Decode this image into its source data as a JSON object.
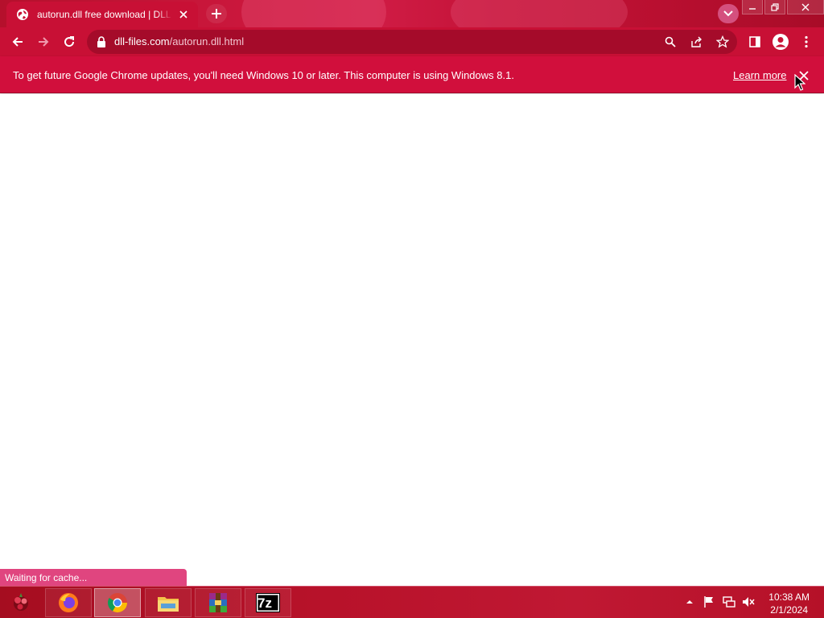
{
  "browser": {
    "tab": {
      "title": "autorun.dll free download | DLL-files.com",
      "favicon": "globe-icon"
    },
    "window_controls": [
      "minimize-icon",
      "restore-icon",
      "close-icon"
    ],
    "toolbar": {
      "back": "back-arrow-icon",
      "forward": "forward-arrow-icon",
      "reload": "reload-icon",
      "url_host": "dll-files.com",
      "url_path": "/autorun.dll.html",
      "omnibox_icons": [
        "search-icon",
        "share-icon",
        "star-icon"
      ],
      "right_icons": [
        "side-panel-icon",
        "profile-icon",
        "menu-dots-icon"
      ]
    },
    "infobar": {
      "message": "To get future Google Chrome updates, you'll need Windows 10 or later. This computer is using Windows 8.1.",
      "learn_more": "Learn more"
    },
    "status": "Waiting for cache..."
  },
  "taskbar": {
    "apps": [
      {
        "name": "Firefox",
        "icon": "firefox-icon"
      },
      {
        "name": "Google Chrome",
        "icon": "chrome-icon",
        "active": true
      },
      {
        "name": "File Explorer",
        "icon": "file-explorer-icon"
      },
      {
        "name": "WinRAR",
        "icon": "winrar-icon"
      },
      {
        "name": "7-Zip",
        "icon": "7zip-icon",
        "label": "7z"
      }
    ],
    "tray_icons": [
      "show-hidden-icons-chevron",
      "action-center-flag-icon",
      "network-icon",
      "volume-muted-icon"
    ],
    "time": "10:38 AM",
    "date": "2/1/2024"
  },
  "colors": {
    "theme_red": "#c81035",
    "infobar_red": "#d10f3c",
    "status_pink": "#e0457f",
    "taskbar_red": "#b8122a"
  }
}
